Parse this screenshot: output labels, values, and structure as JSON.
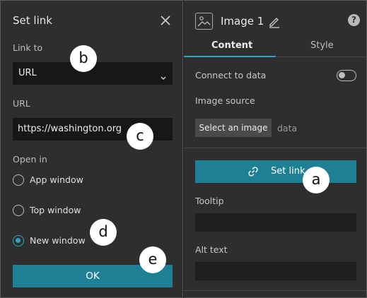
{
  "dialog": {
    "title": "Set link",
    "link_to_label": "Link to",
    "link_to_value": "URL",
    "url_label": "URL",
    "url_value": "https://washington.org",
    "open_in_label": "Open in",
    "options": [
      {
        "label": "App window",
        "selected": false
      },
      {
        "label": "Top window",
        "selected": false
      },
      {
        "label": "New window",
        "selected": true
      }
    ],
    "ok_label": "OK"
  },
  "settings": {
    "title": "Image 1",
    "help_glyph": "?",
    "tabs": [
      {
        "label": "Content",
        "active": true
      },
      {
        "label": "Style",
        "active": false
      }
    ],
    "connect_to_data_label": "Connect to data",
    "connect_to_data_on": false,
    "image_source_label": "Image source",
    "select_image_label": "Select an image",
    "data_label": "data",
    "set_link_label": "Set link",
    "tooltip_label": "Tooltip",
    "tooltip_value": "",
    "alt_text_label": "Alt text",
    "alt_text_value": ""
  },
  "annotations": [
    "a",
    "b",
    "c",
    "d",
    "e"
  ],
  "colors": {
    "accent": "#2ba5bd",
    "primary_button": "#1f7f94",
    "panel_bg": "#2e2e2e",
    "input_bg": "#171717"
  },
  "icons": {
    "close": "close-icon",
    "dropdown": "chevron-down-icon",
    "image": "image-icon",
    "edit": "pencil-icon",
    "help": "help-icon",
    "link": "link-icon"
  }
}
